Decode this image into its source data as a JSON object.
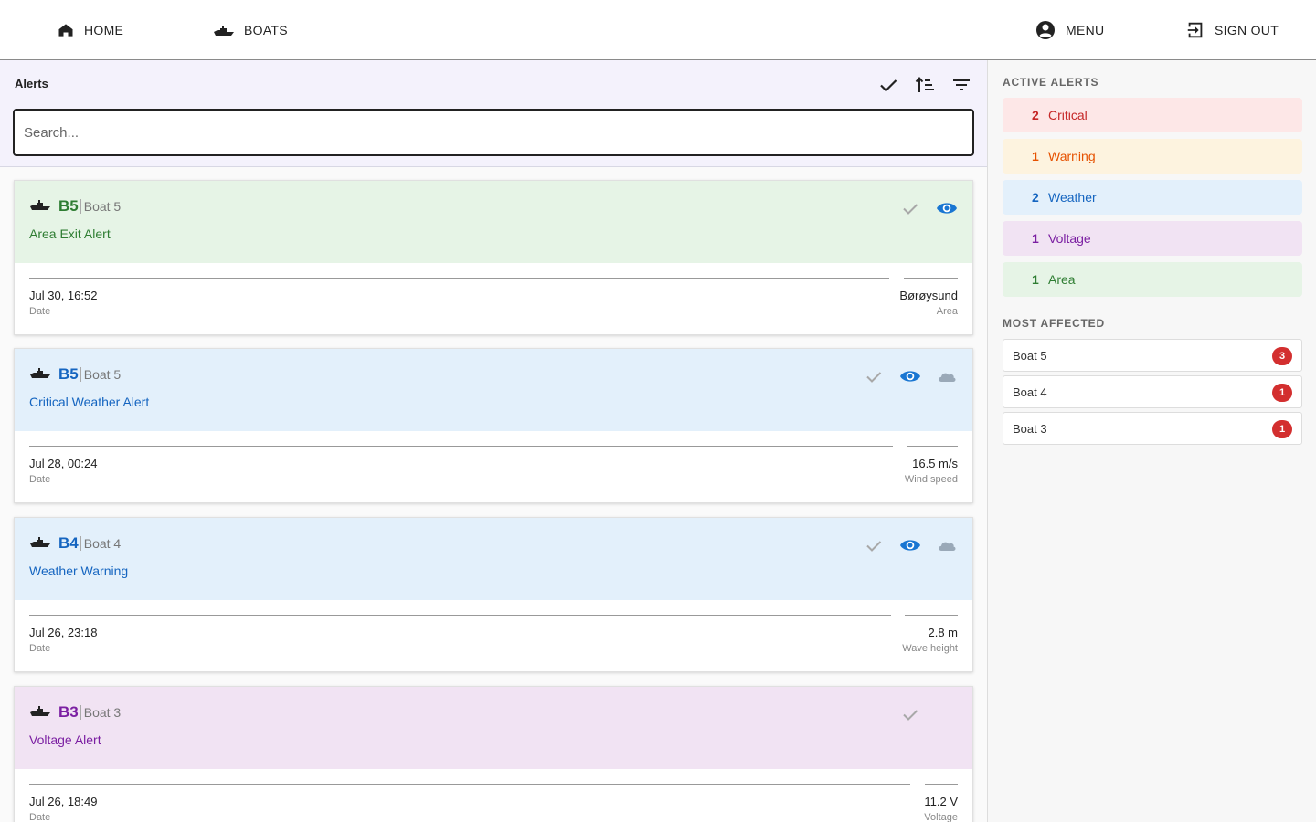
{
  "nav": {
    "home": "HOME",
    "boats": "BOATS",
    "menu": "MENU",
    "sign_out": "SIGN OUT"
  },
  "alerts_panel": {
    "title": "Alerts",
    "search_placeholder": "Search...",
    "header_icons": [
      "check-all-icon",
      "sort-icon",
      "filter-icon"
    ]
  },
  "alerts": [
    {
      "category": "area",
      "code": "B5",
      "boat": "Boat 5",
      "type": "Area Exit Alert",
      "date": "Jul 30, 16:52",
      "date_label": "Date",
      "value": "Børøysund",
      "value_label": "Area",
      "has_eye": true,
      "has_cloud": false
    },
    {
      "category": "weather",
      "code": "B5",
      "boat": "Boat 5",
      "type": "Critical Weather Alert",
      "date": "Jul 28, 00:24",
      "date_label": "Date",
      "value": "16.5 m/s",
      "value_label": "Wind speed",
      "has_eye": true,
      "has_cloud": true
    },
    {
      "category": "weather",
      "code": "B4",
      "boat": "Boat 4",
      "type": "Weather Warning",
      "date": "Jul 26, 23:18",
      "date_label": "Date",
      "value": "2.8 m",
      "value_label": "Wave height",
      "has_eye": true,
      "has_cloud": true
    },
    {
      "category": "voltage",
      "code": "B3",
      "boat": "Boat 3",
      "type": "Voltage Alert",
      "date": "Jul 26, 18:49",
      "date_label": "Date",
      "value": "11.2 V",
      "value_label": "Voltage",
      "has_eye": false,
      "has_cloud": false
    }
  ],
  "sidebar": {
    "active_heading": "ACTIVE ALERTS",
    "active": [
      {
        "count": "2",
        "label": "Critical",
        "style": "critical"
      },
      {
        "count": "1",
        "label": "Warning",
        "style": "warning"
      },
      {
        "count": "2",
        "label": "Weather",
        "style": "weather"
      },
      {
        "count": "1",
        "label": "Voltage",
        "style": "voltage"
      },
      {
        "count": "1",
        "label": "Area",
        "style": "area"
      }
    ],
    "affected_heading": "MOST AFFECTED",
    "affected": [
      {
        "boat": "Boat 5",
        "count": "3"
      },
      {
        "boat": "Boat 4",
        "count": "1"
      },
      {
        "boat": "Boat 3",
        "count": "1"
      }
    ]
  },
  "colors": {
    "area": "#2e7d32",
    "weather": "#1565c0",
    "voltage": "#7b1fa2",
    "critical": "#c62828",
    "warning": "#e65100",
    "eye_icon": "#1976d2",
    "badge": "#d32f2f"
  }
}
